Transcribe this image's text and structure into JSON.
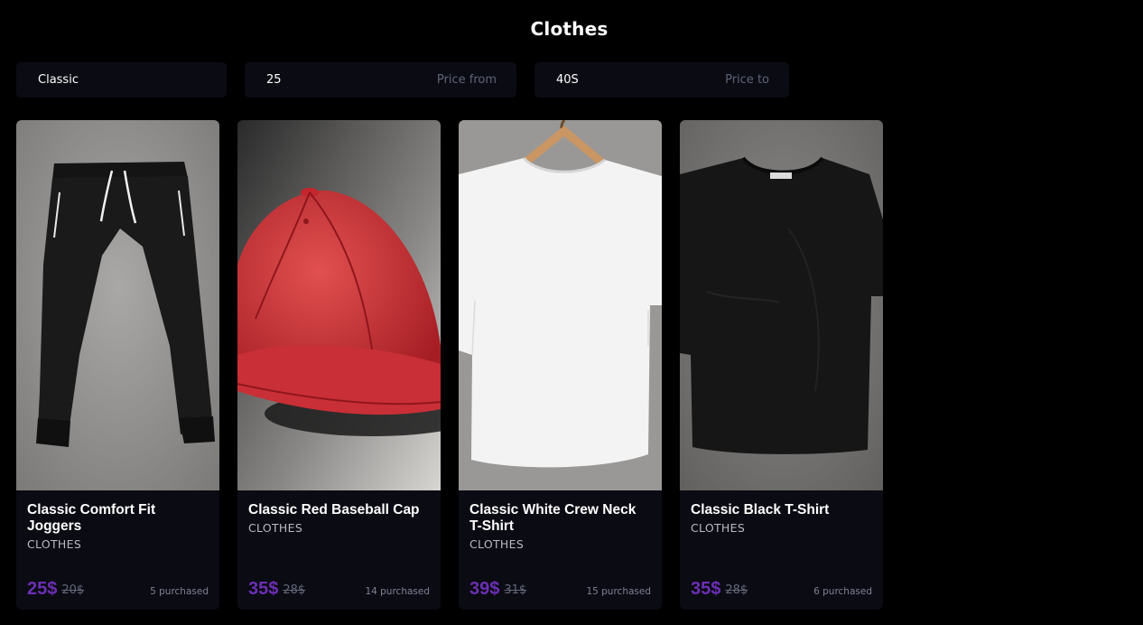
{
  "page": {
    "title": "Clothes"
  },
  "filters": {
    "search_value": "Classic",
    "price_from_value": "25",
    "price_from_suffix": "Price from",
    "price_to_value": "40S",
    "price_to_suffix": "Price to"
  },
  "products": [
    {
      "name": "Classic Comfort Fit Joggers",
      "category": "CLOTHES",
      "price": "25$",
      "old_price": "20$",
      "purchased": "5 purchased"
    },
    {
      "name": "Classic Red Baseball Cap",
      "category": "CLOTHES",
      "price": "35$",
      "old_price": "28$",
      "purchased": "14 purchased"
    },
    {
      "name": "Classic White Crew Neck T-Shirt",
      "category": "CLOTHES",
      "price": "39$",
      "old_price": "31$",
      "purchased": "15 purchased"
    },
    {
      "name": "Classic Black T-Shirt",
      "category": "CLOTHES",
      "price": "35$",
      "old_price": "28$",
      "purchased": "6 purchased"
    }
  ],
  "colors": {
    "background": "#000000",
    "panel": "#0b0b13",
    "accent_price": "#6b2fb3",
    "muted_text": "#5d6478"
  }
}
